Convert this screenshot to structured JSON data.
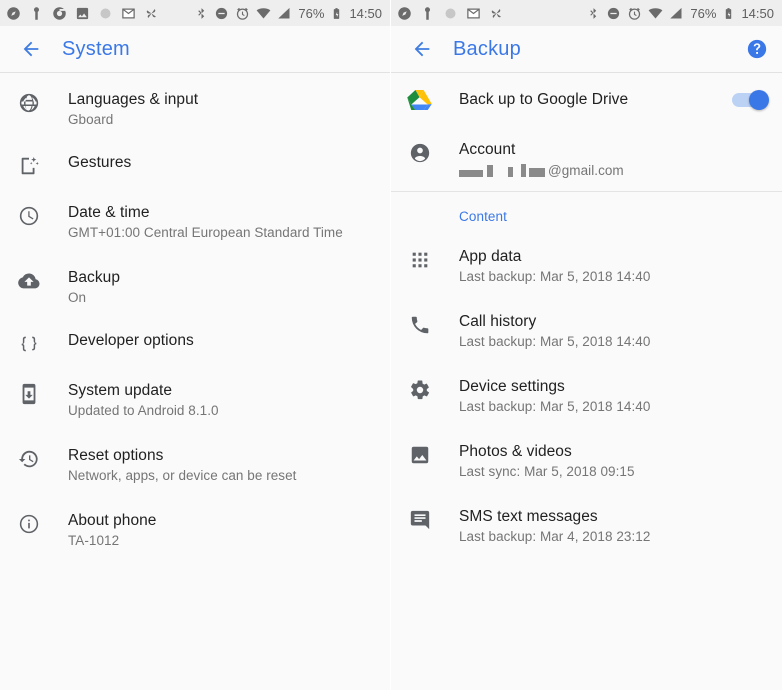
{
  "status_bar": {
    "left_icons": [
      "compass-icon",
      "keyhole-icon",
      "chrome-icon",
      "photo-icon",
      "circle-icon",
      "mail-icon",
      "pinwheel-icon"
    ],
    "right_icons": [
      "bluetooth-icon",
      "do-not-disturb-icon",
      "alarm-icon",
      "wifi-icon",
      "signal-icon"
    ],
    "battery_percent": "76%",
    "battery_icon": "battery-charging-icon",
    "time": "14:50"
  },
  "left_screen": {
    "appbar": {
      "back_icon": "arrow-back-icon",
      "title": "System"
    },
    "items": [
      {
        "icon": "globe-icon",
        "title": "Languages & input",
        "sub": "Gboard"
      },
      {
        "icon": "gestures-icon",
        "title": "Gestures",
        "sub": ""
      },
      {
        "icon": "clock-icon",
        "title": "Date & time",
        "sub": "GMT+01:00 Central European Standard Time"
      },
      {
        "icon": "cloud-upload-icon",
        "title": "Backup",
        "sub": "On"
      },
      {
        "icon": "braces-icon",
        "title": "Developer options",
        "sub": ""
      },
      {
        "icon": "system-update-icon",
        "title": "System update",
        "sub": "Updated to Android 8.1.0"
      },
      {
        "icon": "history-icon",
        "title": "Reset options",
        "sub": "Network, apps, or device can be reset"
      },
      {
        "icon": "info-icon",
        "title": "About phone",
        "sub": "TA-1012"
      }
    ]
  },
  "right_screen": {
    "appbar": {
      "back_icon": "arrow-back-icon",
      "title": "Backup",
      "help_icon": "help-circle-icon"
    },
    "drive_row": {
      "icon": "google-drive-icon",
      "label": "Back up to Google Drive",
      "toggle_on": true
    },
    "account_row": {
      "icon": "account-circle-icon",
      "title": "Account",
      "email_suffix": "@gmail.com",
      "email_redacted": true
    },
    "content_section_label": "Content",
    "content_items": [
      {
        "icon": "apps-grid-icon",
        "title": "App data",
        "sub": "Last backup: Mar 5, 2018 14:40"
      },
      {
        "icon": "phone-icon",
        "title": "Call history",
        "sub": "Last backup: Mar 5, 2018 14:40"
      },
      {
        "icon": "settings-gear-icon",
        "title": "Device settings",
        "sub": "Last backup: Mar 5, 2018 14:40"
      },
      {
        "icon": "photo-icon",
        "title": "Photos & videos",
        "sub": "Last sync: Mar 5, 2018 09:15"
      },
      {
        "icon": "message-icon",
        "title": "SMS text messages",
        "sub": "Last backup: Mar 4, 2018 23:12"
      }
    ]
  },
  "colors": {
    "accent_blue": "#3b78e7",
    "background": "#fafafa",
    "statusbar_bg": "#eeeeee",
    "icon_gray": "#5f6368",
    "title_text": "#212121",
    "sub_text": "#757575"
  }
}
